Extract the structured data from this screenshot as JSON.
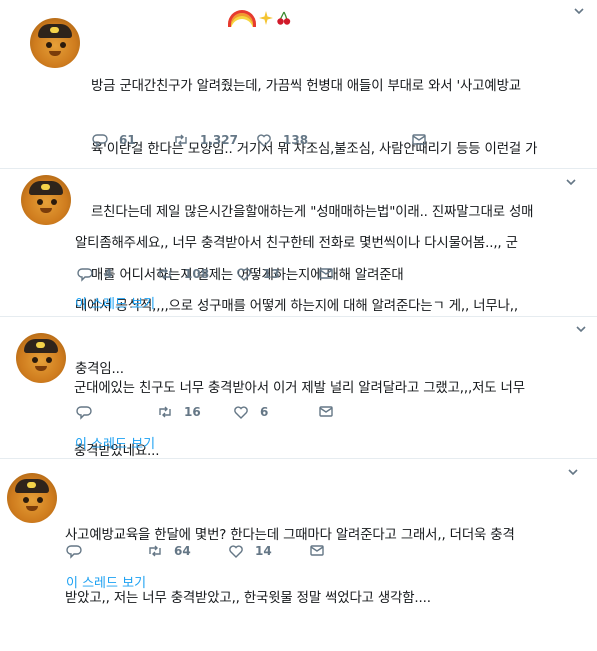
{
  "tweets": [
    {
      "lines": [
        "방금 군대간친구가 알려줬는데, 가끔씩 헌병대 애들이 부대로 와서 '사고예방교",
        "육'이란걸 한다는 모양임.. 거기서 뭐 차조심,불조심, 사람안때리기 등등 이런걸 가",
        "르친다는데 제일 많은시간을할애하는게 \"성매매하는법\"이래.. 진짜말그대로 성매",
        "매를 어디서하는지 결제는 어떻게하는지에 대해 알려준대"
      ],
      "replies": "61",
      "retweets": "1,327",
      "likes": "138",
      "thread_link": ""
    },
    {
      "lines": [
        "알티좀해주세요,, 너무 충격받아서 친구한테 전화로 몇번씩이나 다시물어봄..,, 군",
        "대에서 공식적,,,,으로 성구매를 어떻게 하는지에 대해 알려준다는ㄱ 게,, 너무나,,",
        "충격임..."
      ],
      "replies": "4",
      "retweets": "108",
      "likes": "13",
      "thread_link": "이 스레드 보기"
    },
    {
      "lines": [
        "군대에있는 친구도 너무 충격받아서 이거 제발 널리 알려달라고 그랬고,,,저도 너무",
        "충격받았네요..."
      ],
      "replies": "",
      "retweets": "16",
      "likes": "6",
      "thread_link": "이 스레드 보기"
    },
    {
      "lines": [
        "사고예방교육을 한달에 몇번? 한다는데 그때마다 알려준다고 그래서,, 더더욱 충격",
        "받았고,, 저는 너무 충격받았고,, 한국윗물 정말 썩었다고 생각함...."
      ],
      "replies": "",
      "retweets": "64",
      "likes": "14",
      "thread_link": "이 스레드 보기"
    }
  ],
  "icons": {
    "reply": "reply-icon",
    "retweet": "retweet-icon",
    "like": "like-icon",
    "caret": "chevron-down-icon"
  },
  "colors": {
    "link": "#1da1f2",
    "muted": "#657786",
    "divider": "#e6ecf0"
  }
}
